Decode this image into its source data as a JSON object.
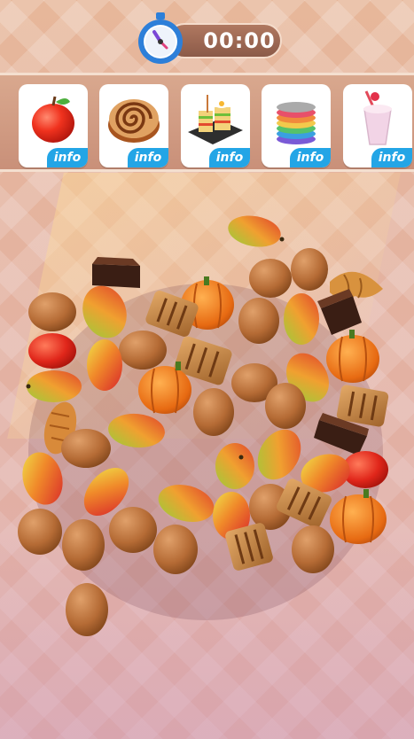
{
  "timer": {
    "value": "00:00",
    "icon": "stopwatch-icon"
  },
  "shelf": {
    "cards": [
      {
        "item": "apple",
        "info_label": "info"
      },
      {
        "item": "cinnamon-roll",
        "info_label": "info"
      },
      {
        "item": "club-sandwich",
        "info_label": "info"
      },
      {
        "item": "macaron-stack",
        "info_label": "info"
      },
      {
        "item": "milkshake",
        "info_label": "info"
      }
    ]
  },
  "pile": {
    "items": [
      "mango",
      "potato",
      "pumpkin",
      "toast",
      "chocolate-cake",
      "croissant",
      "bread-loaf",
      "apple"
    ]
  },
  "colors": {
    "info_badge": "#23a5e6",
    "shelf": "#c99079",
    "timer_pill": "#8b5a48",
    "clock_ring": "#2d7fd9"
  }
}
